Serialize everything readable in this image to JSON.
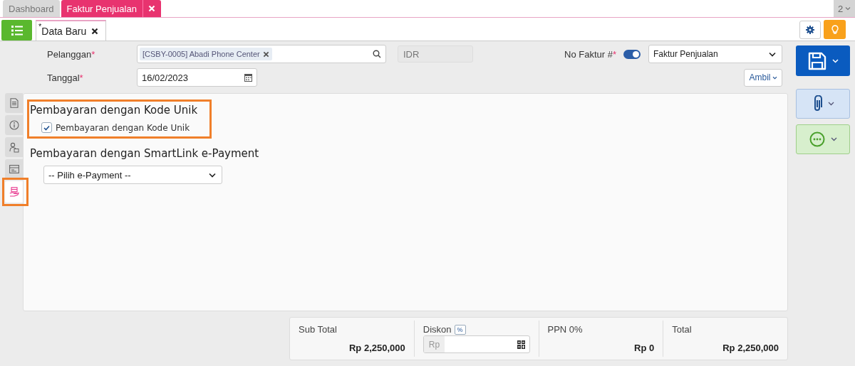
{
  "tabs": [
    {
      "label": "Dashboard",
      "selected": false,
      "closable": false
    },
    {
      "label": "Faktur Penjualan",
      "selected": true,
      "closable": true
    }
  ],
  "tab_counter": "2",
  "doc_tab": {
    "marker": "*",
    "label": "Data Baru"
  },
  "form": {
    "customer": {
      "label": "Pelanggan",
      "required": true,
      "value": "[CSBY-0005] Abadi Phone Center"
    },
    "currency": "IDR",
    "date": {
      "label": "Tanggal",
      "required": true,
      "value": "16/02/2023"
    },
    "invoice_no": {
      "label": "No Faktur #",
      "required": true,
      "on": true,
      "value": "Faktur Penjualan"
    },
    "fetch_button": "Ambil"
  },
  "side_tabs": [
    {
      "kind": "document",
      "selected": false,
      "highlighted": false
    },
    {
      "kind": "info",
      "selected": false,
      "highlighted": false
    },
    {
      "kind": "person",
      "selected": false,
      "highlighted": false
    },
    {
      "kind": "card",
      "selected": false,
      "highlighted": false
    },
    {
      "kind": "payment",
      "selected": true,
      "highlighted": true
    }
  ],
  "sections": [
    {
      "kind": "checkbox",
      "title": "Pembayaran dengan Kode Unik",
      "highlighted": true,
      "label": "Pembayaran dengan Kode Unik",
      "checked": true
    },
    {
      "kind": "select",
      "title": "Pembayaran dengan SmartLink e-Payment",
      "highlighted": false,
      "value": "-- Pilih e-Payment --"
    }
  ],
  "totals": [
    {
      "kind": "amount",
      "label": "Sub Total",
      "value": "Rp 2,250,000"
    },
    {
      "kind": "discount",
      "label": "Diskon",
      "badge": "%",
      "prefix": "Rp"
    },
    {
      "kind": "amount",
      "label": "PPN 0%",
      "value": "Rp 0"
    },
    {
      "kind": "amount",
      "label": "Total",
      "value": "Rp 2,250,000"
    }
  ]
}
